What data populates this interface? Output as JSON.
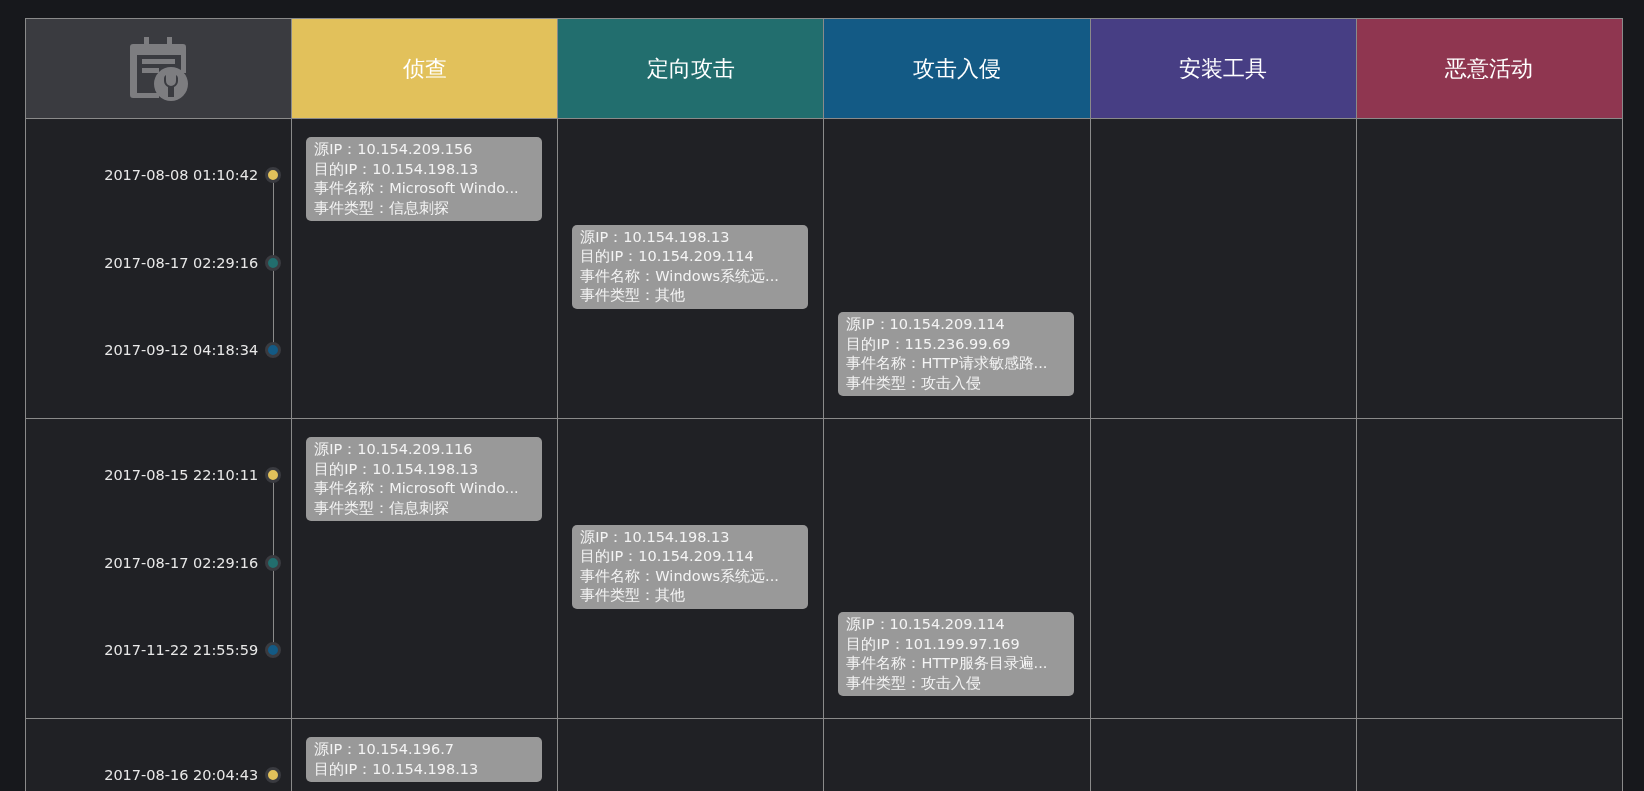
{
  "columns": [
    {
      "label": "侦查",
      "color": "#e2c15b"
    },
    {
      "label": "定向攻击",
      "color": "#226e6e"
    },
    {
      "label": "攻击入侵",
      "color": "#135a85"
    },
    {
      "label": "安装工具",
      "color": "#473e84"
    },
    {
      "label": "恶意活动",
      "color": "#8f3650"
    }
  ],
  "rows": [
    {
      "events": [
        {
          "time": "2017-08-08 01:10:42",
          "kind": "recon",
          "lines": [
            "源IP：10.154.209.156",
            "目的IP：10.154.198.13",
            "事件名称：Microsoft Windo...",
            "事件类型：信息刺探"
          ]
        },
        {
          "time": "2017-08-17 02:29:16",
          "kind": "targeted",
          "lines": [
            "源IP：10.154.198.13",
            "目的IP：10.154.209.114",
            "事件名称：Windows系统远...",
            "事件类型：其他"
          ]
        },
        {
          "time": "2017-09-12 04:18:34",
          "kind": "intrusion",
          "lines": [
            "源IP：10.154.209.114",
            "目的IP：115.236.99.69",
            "事件名称：HTTP请求敏感路...",
            "事件类型：攻击入侵"
          ]
        }
      ]
    },
    {
      "events": [
        {
          "time": "2017-08-15 22:10:11",
          "kind": "recon",
          "lines": [
            "源IP：10.154.209.116",
            "目的IP：10.154.198.13",
            "事件名称：Microsoft Windo...",
            "事件类型：信息刺探"
          ]
        },
        {
          "time": "2017-08-17 02:29:16",
          "kind": "targeted",
          "lines": [
            "源IP：10.154.198.13",
            "目的IP：10.154.209.114",
            "事件名称：Windows系统远...",
            "事件类型：其他"
          ]
        },
        {
          "time": "2017-11-22 21:55:59",
          "kind": "intrusion",
          "lines": [
            "源IP：10.154.209.114",
            "目的IP：101.199.97.169",
            "事件名称：HTTP服务目录遍...",
            "事件类型：攻击入侵"
          ]
        }
      ]
    },
    {
      "events": [
        {
          "time": "2017-08-16 20:04:43",
          "kind": "recon",
          "lines": [
            "源IP：10.154.196.7",
            "目的IP：10.154.198.13"
          ]
        }
      ]
    }
  ]
}
